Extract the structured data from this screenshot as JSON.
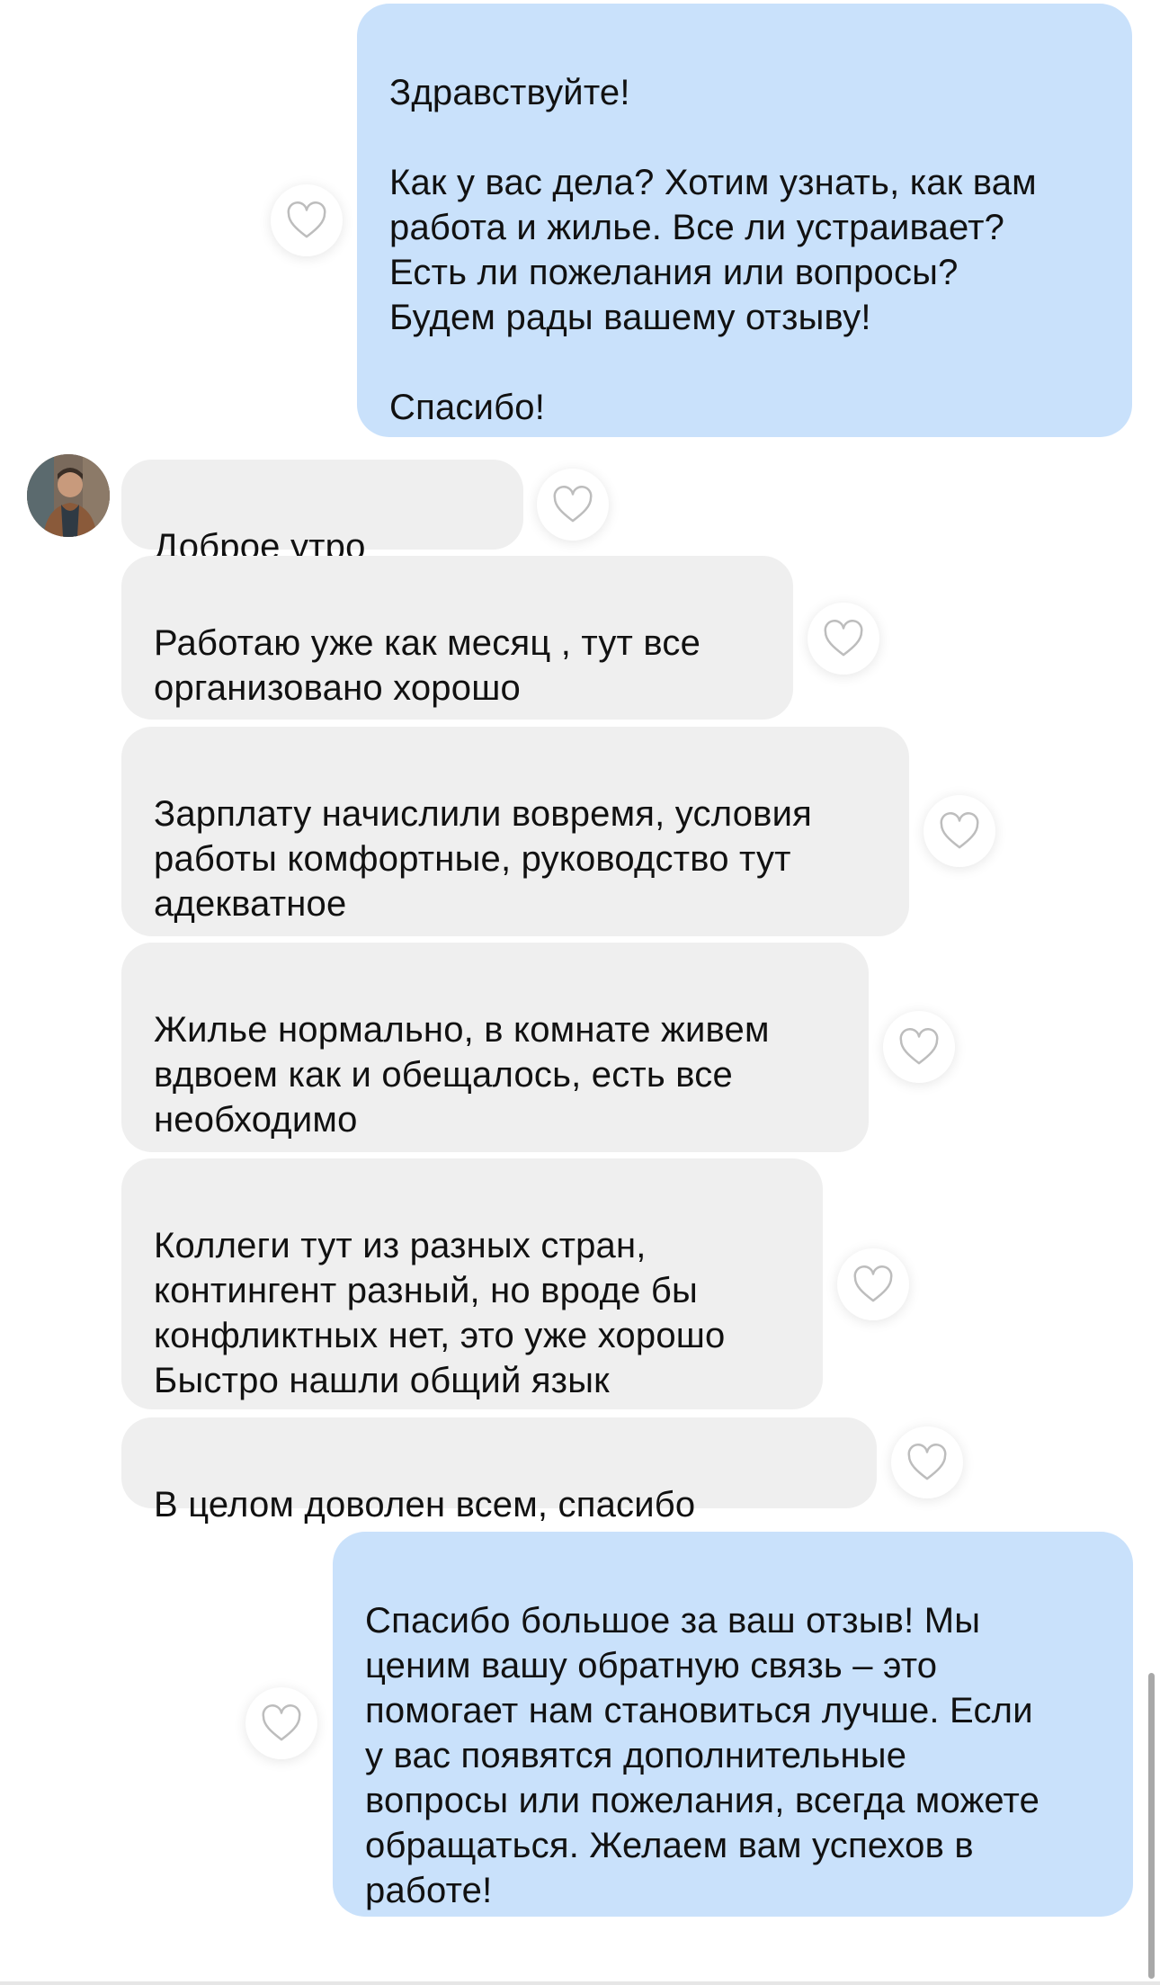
{
  "messages": [
    {
      "direction": "outgoing",
      "text": "Здравствуйте!\n\nКак у вас дела? Хотим узнать, как вам\nработа и жилье. Все ли устраивает?\nЕсть ли пожелания или вопросы?\nБудем рады вашему отзыву!\n\nСпасибо!"
    },
    {
      "direction": "incoming",
      "text": "Доброе утро"
    },
    {
      "direction": "incoming",
      "text": "Работаю уже как месяц , тут все\nорганизовано хорошо"
    },
    {
      "direction": "incoming",
      "text": "Зарплату начислили вовремя, условия\nработы комфортные, руководство тут\nадекватное"
    },
    {
      "direction": "incoming",
      "text": "Жилье нормально, в комнате живем\nвдвоем как и обещалось, есть все\nнеобходимо"
    },
    {
      "direction": "incoming",
      "text": "Коллеги тут из разных стран,\nконтингент разный, но вроде бы\nконфликтных нет, это уже хорошо\nБыстро нашли общий язык"
    },
    {
      "direction": "incoming",
      "text": "В целом доволен всем, спасибо"
    },
    {
      "direction": "outgoing",
      "text": "Спасибо большое за ваш отзыв! Мы\nценим вашу обратную связь – это\nпомогает нам становиться лучше. Если\nу вас появятся дополнительные\nвопросы или пожелания, всегда можете\nобращаться. Желаем вам успехов в\nработе!"
    }
  ],
  "icons": {
    "like": "heart-outline-icon",
    "avatar": "user-avatar"
  },
  "colors": {
    "outgoing_bubble": "#c9e1fb",
    "incoming_bubble": "#efefef",
    "heart_stroke": "#bdbdbd"
  }
}
